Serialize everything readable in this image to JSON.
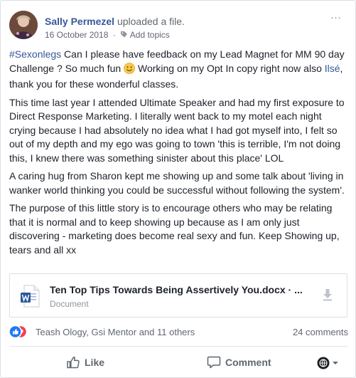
{
  "post": {
    "author": "Sally Permezel",
    "action": "uploaded a file.",
    "date": "16 October 2018",
    "add_topics": "Add topics",
    "more_label": "…"
  },
  "body": {
    "p1": {
      "hashtag": "#Sexonlegs",
      "text_a": " Can I please have feedback on my Lead Magnet for MM 90 day Challenge ? So much fun ",
      "emoji": "smiling-face",
      "text_b": " Working on my Opt In copy right now also ",
      "mention": "Ilsé",
      "text_c": ", thank you for these wonderful classes."
    },
    "p2": "This time last year I attended Ultimate Speaker and had my first exposure to Direct Response Marketing. I literally went back to my motel each night crying because I had absolutely no idea what I had got myself into, I felt so out of my depth and my ego was going to town 'this is terrible, I'm not doing this, I knew there was something sinister about this place' LOL",
    "p3": "A caring hug from Sharon kept me showing up and some talk about 'living in wanker world thinking you could be successful without following the system'.",
    "p4": "The purpose of this little story is to encourage others who may be relating that it is normal and to keep showing up because as I am only just discovering - marketing does become real sexy and fun. Keep Showing up, tears and all xx"
  },
  "attachment": {
    "title": "Ten Top Tips Towards Being Assertively You.docx · ...",
    "subtitle": "Document",
    "icon": "word-document-icon"
  },
  "reactions": {
    "icons": [
      "like-icon",
      "love-icon"
    ],
    "names": "Teash Ology, Gsi Mentor and 11 others",
    "comments": "24 comments"
  },
  "actions": {
    "like": "Like",
    "comment": "Comment"
  },
  "colors": {
    "link": "#365899",
    "secondary": "#616770",
    "like_blue": "#2078f4",
    "love_red": "#f33e58",
    "word_blue": "#2b579a"
  }
}
